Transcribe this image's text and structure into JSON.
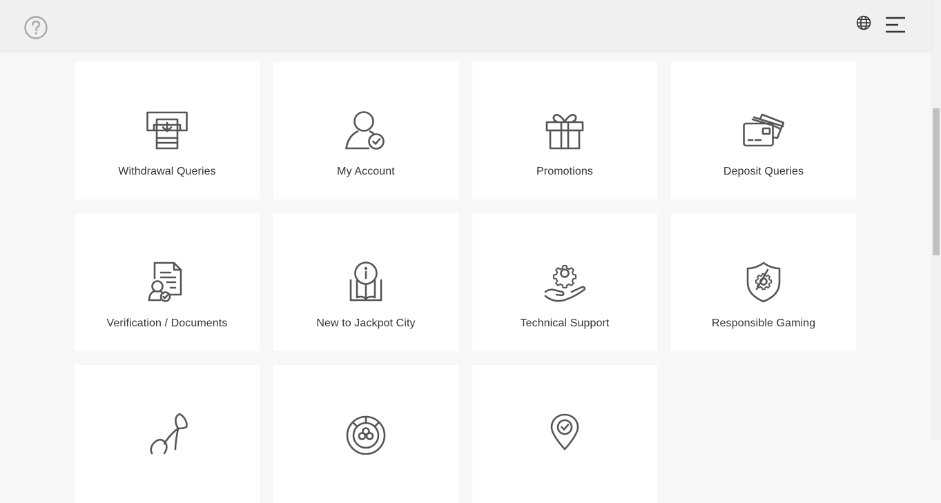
{
  "header": {
    "help_icon": "question-circle-icon",
    "language_icon": "globe-icon",
    "menu_icon": "hamburger-menu-icon"
  },
  "categories": [
    {
      "label": "Withdrawal Queries",
      "icon": "atm-withdrawal-icon"
    },
    {
      "label": "My Account",
      "icon": "user-check-icon"
    },
    {
      "label": "Promotions",
      "icon": "gift-icon"
    },
    {
      "label": "Deposit Queries",
      "icon": "credit-cards-icon"
    },
    {
      "label": "Verification / Documents",
      "icon": "document-user-icon"
    },
    {
      "label": "New to Jackpot City",
      "icon": "book-info-icon"
    },
    {
      "label": "Technical Support",
      "icon": "hand-gear-icon"
    },
    {
      "label": "Responsible Gaming",
      "icon": "shield-gear-icon"
    },
    {
      "label": "",
      "icon": "cherry-icon"
    },
    {
      "label": "",
      "icon": "casino-chip-icon"
    },
    {
      "label": "",
      "icon": "location-pin-check-icon"
    }
  ],
  "colors": {
    "header_bg": "#eef0f1",
    "page_bg": "#f7f7f7",
    "card_bg": "#ffffff",
    "icon_stroke": "#555555",
    "text": "#333333"
  }
}
